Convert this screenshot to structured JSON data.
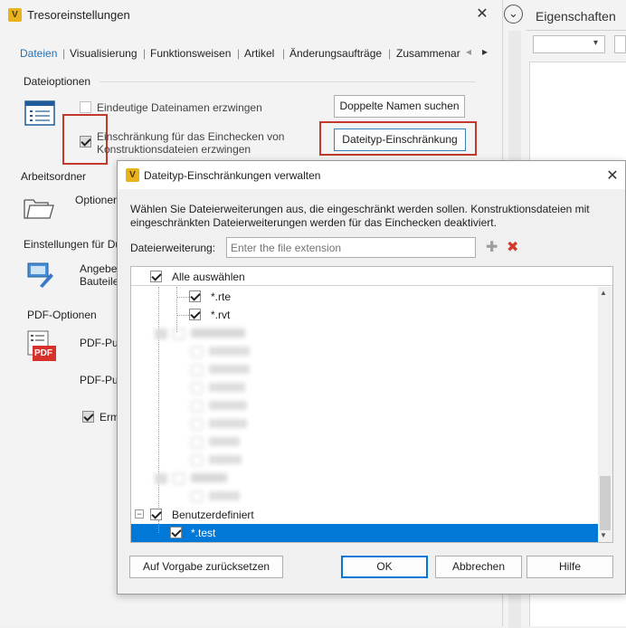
{
  "main_window": {
    "title": "Tresoreinstellungen",
    "logo_letter": "V",
    "close_glyph": "✕",
    "tabs": [
      "Dateien",
      "Visualisierung",
      "Funktionsweisen",
      "Artikel",
      "Änderungsaufträge",
      "Zusammenar"
    ],
    "tab_separator": "|",
    "tab_prev_glyph": "◂",
    "tab_next_glyph": "▸",
    "sections": {
      "file_options": "Dateioptionen",
      "working_folder": "Arbeitsordner",
      "settings_for": "Einstellungen für Du",
      "pdf_options": "PDF-Optionen"
    },
    "unique_names_label": "Eindeutige Dateinamen erzwingen",
    "find_duplicates_button": "Doppelte Namen suchen",
    "restrict_checkin_label_1": "Einschränkung für das Einchecken von",
    "restrict_checkin_label_2": "Konstruktionsdateien erzwingen",
    "filetype_restriction_button": "Dateityp-Einschränkung",
    "options_label": "Optionen",
    "angebe_label": "Angebe",
    "bauteile_label": "Bauteile",
    "pdf_pu_label_1": "PDF-Pu",
    "pdf_pu_label_2": "PDF-Pu",
    "erm_label": "Erm",
    "pdf_icon_text": "PDF"
  },
  "side_panel": {
    "title": "Eigenschaften",
    "collapse_glyph": "⌄",
    "close_glyph": "✕",
    "dropdown_arrow": "▾"
  },
  "dialog": {
    "title": "Dateityp-Einschränkungen verwalten",
    "logo_letter": "V",
    "close_glyph": "✕",
    "description_1": "Wählen Sie Dateierweiterungen aus, die eingeschränkt werden sollen. Konstruktionsdateien mit",
    "description_2": "eingeschränkten Dateierweiterungen werden für das Einchecken deaktiviert.",
    "extension_label": "Dateierweiterung:",
    "extension_placeholder": "Enter the file extension",
    "add_glyph": "✚",
    "delete_glyph": "✖",
    "select_all": "Alle auswählen",
    "tree_items": {
      "rte": "*.rte",
      "rvt": "*.rvt",
      "custom": "Benutzerdefiniert",
      "test": "*.test"
    },
    "scroll_up": "▲",
    "scroll_down": "▼",
    "expander_minus": "−",
    "buttons": {
      "reset": "Auf Vorgabe zurücksetzen",
      "ok": "OK",
      "cancel": "Abbrechen",
      "help": "Hilfe"
    }
  }
}
